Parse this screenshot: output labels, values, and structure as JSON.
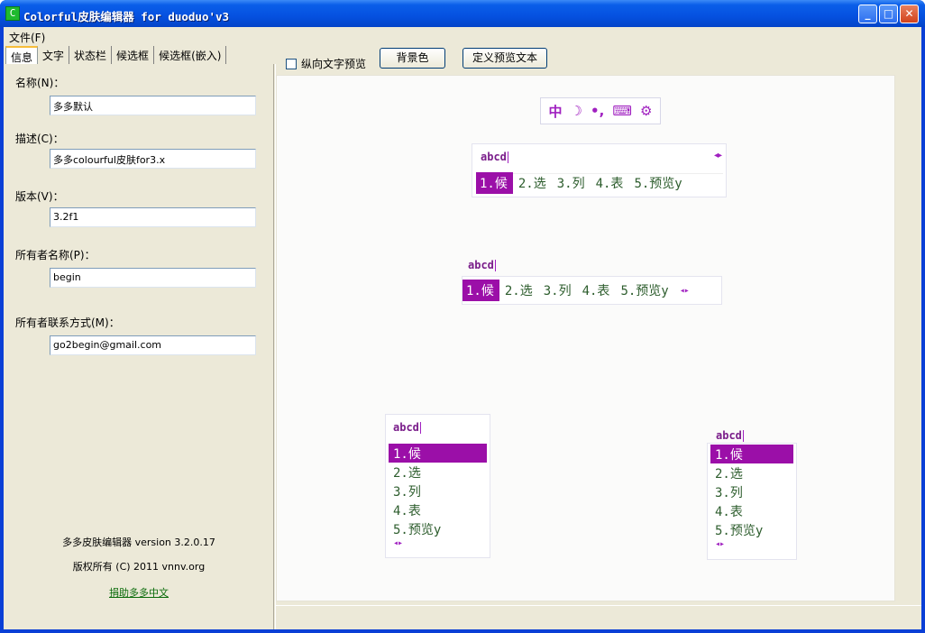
{
  "window": {
    "title": "Colorful皮肤编辑器 for duoduo'v3",
    "icon": "app-icon",
    "minimize": "_",
    "maximize": "□",
    "close": "✕"
  },
  "menu": {
    "file": "文件(F)"
  },
  "tabs": [
    "信息",
    "文字",
    "状态栏",
    "候选框",
    "候选框(嵌入)"
  ],
  "info": {
    "name_label": "名称(N)：",
    "name_value": "多多默认",
    "desc_label": "描述(C)：",
    "desc_value": "多多colourful皮肤for3.x",
    "version_label": "版本(V)：",
    "version_value": "3.2f1",
    "owner_label": "所有者名称(P)：",
    "owner_value": "begin",
    "contact_label": "所有者联系方式(M)：",
    "contact_value": "go2begin@gmail.com"
  },
  "about": {
    "version": "多多皮肤编辑器 version 3.2.0.17",
    "copyright": "版权所有 (C) 2011 vnnv.org",
    "donate": "捐助多多中文"
  },
  "toolbar": {
    "vertical_preview": "纵向文字预览",
    "bg_color": "背景色",
    "define_text": "定义预览文本"
  },
  "preview": {
    "statusbar_icons": [
      "中",
      "☽",
      "•,",
      "⌨",
      "⚙"
    ],
    "composition": "abcd",
    "candidates": [
      "1.候",
      "2.选",
      "3.列",
      "4.表",
      "5.预览y"
    ],
    "arrows": "◂▸"
  },
  "colors": {
    "accent": "#9b0fa8",
    "titlebar": "#0551e0",
    "candidate_text": "#2d5d2d"
  }
}
